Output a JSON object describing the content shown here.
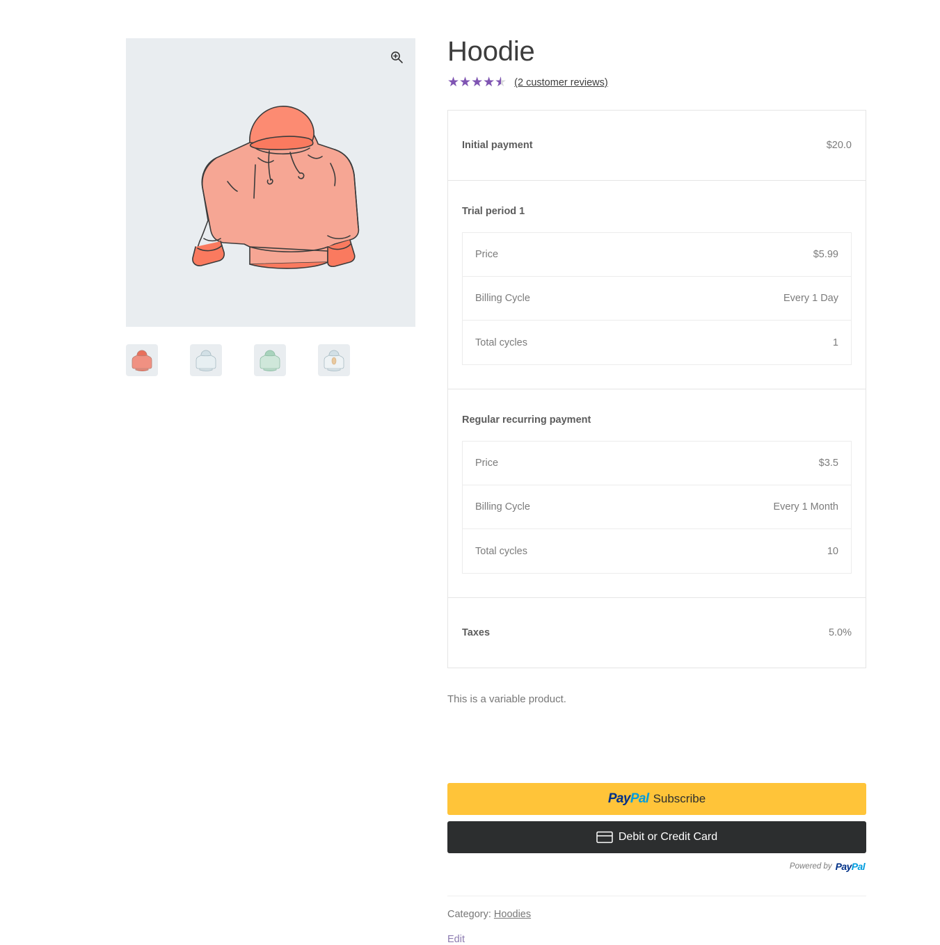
{
  "product": {
    "title": "Hoodie",
    "rating_value": 4.5,
    "rating_max": 5,
    "reviews_link": "(2 customer reviews)",
    "short_description": "This is a variable product.",
    "category_label": "Category:",
    "category_name": "Hoodies",
    "edit_label": "Edit"
  },
  "gallery": {
    "zoom_icon": "zoom-in-icon",
    "main_image_alt": "salmon hoodie illustration",
    "thumbnails": [
      {
        "name": "thumb-hoodie-salmon",
        "color": "#f08e7d",
        "accent": "#e8705c",
        "logo": false
      },
      {
        "name": "thumb-hoodie-white-blue",
        "color": "#dde8ec",
        "accent": "#c6d8de",
        "logo": false
      },
      {
        "name": "thumb-hoodie-mint",
        "color": "#cfe7da",
        "accent": "#a9d3bd",
        "logo": false
      },
      {
        "name": "thumb-hoodie-white-logo",
        "color": "#e3eaee",
        "accent": "#c9d7de",
        "logo": true
      }
    ]
  },
  "price_table": {
    "initial": {
      "label": "Initial payment",
      "value": "$20.0"
    },
    "trial": {
      "title": "Trial period 1",
      "rows": [
        {
          "label": "Price",
          "value": "$5.99"
        },
        {
          "label": "Billing Cycle",
          "value": "Every 1 Day"
        },
        {
          "label": "Total cycles",
          "value": "1"
        }
      ]
    },
    "regular": {
      "title": "Regular recurring payment",
      "rows": [
        {
          "label": "Price",
          "value": "$3.5"
        },
        {
          "label": "Billing Cycle",
          "value": "Every 1 Month"
        },
        {
          "label": "Total cycles",
          "value": "10"
        }
      ]
    },
    "taxes": {
      "label": "Taxes",
      "value": "5.0%"
    }
  },
  "paypal": {
    "subscribe_logo_pay": "Pay",
    "subscribe_logo_pal": "Pal",
    "subscribe_label": "Subscribe",
    "card_label": "Debit or Credit Card",
    "card_icon": "credit-card-icon",
    "powered_text": "Powered by",
    "powered_logo_pay": "Pay",
    "powered_logo_pal": "Pal"
  },
  "colors": {
    "brand_purple": "#7f54b3",
    "paypal_gold": "#ffc439",
    "paypal_dark": "#2c2e2f",
    "paypal_navy": "#003087",
    "paypal_blue": "#009cde",
    "image_bg": "#e9edf0"
  }
}
